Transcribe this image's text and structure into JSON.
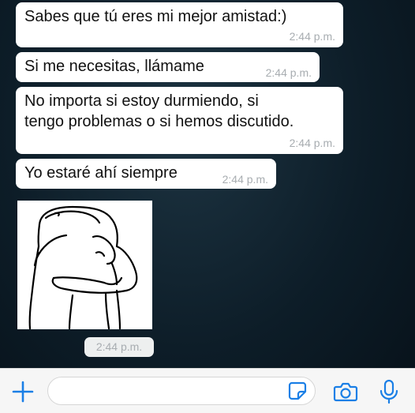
{
  "messages": [
    {
      "text": "Sabes que tú eres mi mejor amistad:)",
      "time": "2:44 p.m."
    },
    {
      "text": "Si me necesitas, llámame",
      "time": "2:44 p.m."
    },
    {
      "text_lines": [
        "No importa si estoy durmiendo, si",
        "tengo problemas o si hemos discutido."
      ],
      "time": "2:44 p.m."
    },
    {
      "text": "Yo estaré ahí siempre",
      "time": "2:44 p.m."
    }
  ],
  "image_message": {
    "content": "line drawing of a figure hugging itself",
    "time": "2:44 p.m."
  },
  "input_bar": {
    "placeholder": "",
    "value": "",
    "icons": [
      "plus-icon",
      "sticker-icon",
      "camera-icon",
      "microphone-icon"
    ],
    "accent_color": "#1a7fe6"
  },
  "colors": {
    "bubble": "#ffffff",
    "timestamp": "#a8adb1",
    "wallpaper": "#0d1d28"
  }
}
